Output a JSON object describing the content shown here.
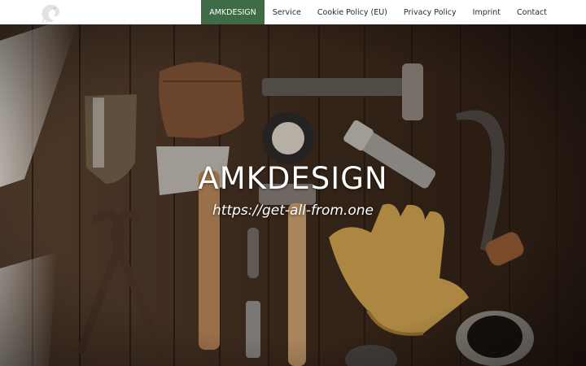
{
  "header": {
    "logo_icon": "chameleon-logo-icon",
    "nav": [
      {
        "label": "AMKDESIGN",
        "active": true
      },
      {
        "label": "Service",
        "active": false
      },
      {
        "label": "Cookie Policy (EU)",
        "active": false
      },
      {
        "label": "Privacy Policy",
        "active": false
      },
      {
        "label": "Imprint",
        "active": false
      },
      {
        "label": "Contact",
        "active": false
      }
    ]
  },
  "hero": {
    "title": "AMKDESIGN",
    "subtitle": "https://get-all-from.one",
    "background_image": "tools-on-wooden-table"
  },
  "colors": {
    "nav_active_bg": "#3f6b46",
    "nav_text": "#2b2b2b",
    "hero_text": "#ffffff"
  }
}
